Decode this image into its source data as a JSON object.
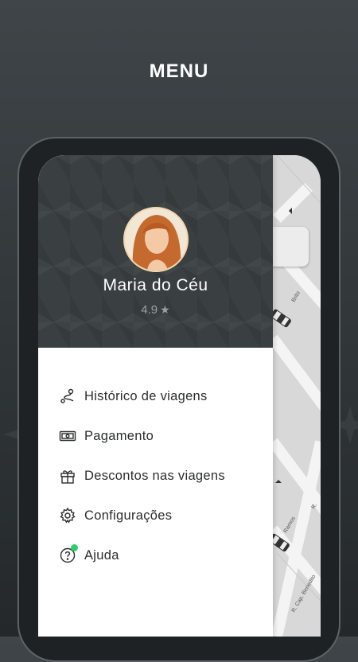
{
  "page": {
    "title": "MENU"
  },
  "user": {
    "name": "Maria do Céu",
    "rating": "4.9"
  },
  "menu": {
    "items": [
      {
        "label": "Histórico de viagens",
        "icon": "route-icon"
      },
      {
        "label": "Pagamento",
        "icon": "cash-icon"
      },
      {
        "label": "Descontos nas viagens",
        "icon": "gift-icon"
      },
      {
        "label": "Configurações",
        "icon": "gear-icon"
      },
      {
        "label": "Ajuda",
        "icon": "help-icon",
        "has_notification": true
      }
    ]
  },
  "map": {
    "street_labels": [
      "Brito",
      "Ramos",
      "R. Cap. Benedito",
      "R."
    ]
  },
  "colors": {
    "background": "#2f3437",
    "drawer_header": "#3a3f41",
    "notification": "#2ecc71",
    "text_dark": "#2a2d2f"
  }
}
